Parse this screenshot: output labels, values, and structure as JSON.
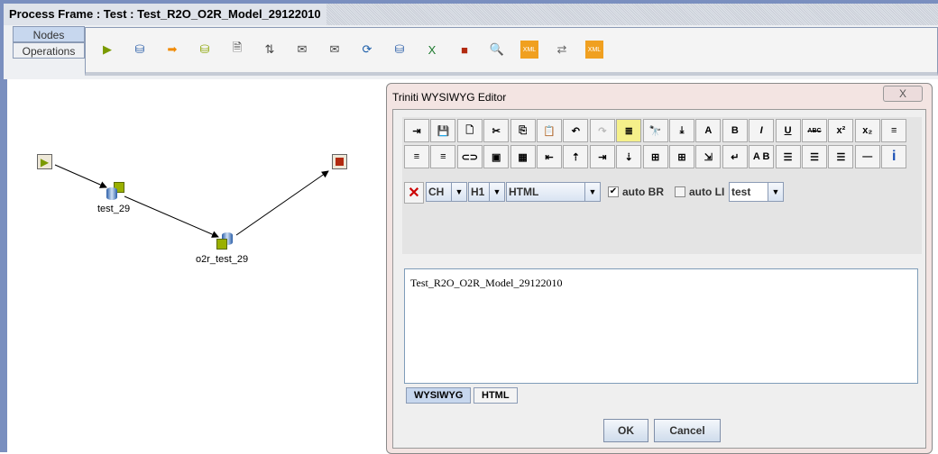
{
  "window": {
    "title": "Process Frame : Test : Test_R2O_O2R_Model_29122010"
  },
  "tabs": [
    {
      "label": "Nodes",
      "selected": true
    },
    {
      "label": "Operations",
      "selected": false
    }
  ],
  "toolbar": {
    "icons": [
      {
        "name": "start-node-icon",
        "glyph": "▶",
        "color": "#7a9a00"
      },
      {
        "name": "db-to-object-icon",
        "glyph": "⛁",
        "color": "#2a5ea8"
      },
      {
        "name": "arrow-right-icon",
        "glyph": "➡",
        "color": "#f08a00"
      },
      {
        "name": "object-to-db-icon",
        "glyph": "⛁",
        "color": "#8aa400"
      },
      {
        "name": "file-db-icon",
        "glyph": "🗎",
        "color": "#444"
      },
      {
        "name": "file-transfer-icon",
        "glyph": "⇅",
        "color": "#444"
      },
      {
        "name": "mail-add-icon",
        "glyph": "✉",
        "color": "#444"
      },
      {
        "name": "mail-file-icon",
        "glyph": "✉",
        "color": "#444"
      },
      {
        "name": "web-service-icon",
        "glyph": "⟳",
        "color": "#1a5ca8"
      },
      {
        "name": "db-file-icon",
        "glyph": "⛁",
        "color": "#2a5ea8"
      },
      {
        "name": "excel-icon",
        "glyph": "X",
        "color": "#1d7a2e"
      },
      {
        "name": "stop-node-icon",
        "glyph": "■",
        "color": "#b22a10"
      },
      {
        "name": "search-user-icon",
        "glyph": "🔍",
        "color": "#444"
      },
      {
        "name": "xml-object-icon",
        "glyph": "XML",
        "color": "#d06000"
      },
      {
        "name": "transform-icon",
        "glyph": "⇄",
        "color": "#666"
      },
      {
        "name": "xml-db-icon",
        "glyph": "XML",
        "color": "#8aa400"
      }
    ]
  },
  "canvas": {
    "nodes": [
      {
        "name": "start-node",
        "label": ""
      },
      {
        "name": "test-29-node",
        "label": "test_29"
      },
      {
        "name": "o2r-test-29-node",
        "label": "o2r_test_29"
      },
      {
        "name": "stop-node",
        "label": ""
      }
    ]
  },
  "dialog": {
    "title": "Triniti WYSIWYG Editor",
    "close_glyph": "X",
    "row1": [
      {
        "name": "insert-file",
        "g": "⇥"
      },
      {
        "name": "save",
        "g": "💾"
      },
      {
        "name": "new",
        "g": "🗋"
      },
      {
        "name": "cut",
        "g": "✂"
      },
      {
        "name": "copy",
        "g": "⎘"
      },
      {
        "name": "paste",
        "g": "📋"
      },
      {
        "name": "undo",
        "g": "↶"
      },
      {
        "name": "redo",
        "g": "↷"
      },
      {
        "name": "highlight",
        "g": "≣"
      },
      {
        "name": "find",
        "g": "🔭"
      },
      {
        "name": "find-next",
        "g": "⤓"
      },
      {
        "name": "font",
        "g": "A"
      },
      {
        "name": "bold",
        "g": "B"
      },
      {
        "name": "italic",
        "g": "I"
      },
      {
        "name": "underline",
        "g": "U"
      },
      {
        "name": "strikethrough",
        "g": "ABC"
      },
      {
        "name": "superscript",
        "g": "x²"
      },
      {
        "name": "subscript",
        "g": "x₂"
      },
      {
        "name": "align-left",
        "g": "≡"
      }
    ],
    "row2": [
      {
        "name": "align-center",
        "g": "≡"
      },
      {
        "name": "align-right",
        "g": "≡"
      },
      {
        "name": "link",
        "g": "⊂⊃"
      },
      {
        "name": "image",
        "g": "▣"
      },
      {
        "name": "table",
        "g": "▦"
      },
      {
        "name": "insert-column",
        "g": "⇤"
      },
      {
        "name": "insert-row",
        "g": "⇡"
      },
      {
        "name": "delete-column",
        "g": "⇥"
      },
      {
        "name": "delete-row",
        "g": "⇣"
      },
      {
        "name": "table-props",
        "g": "⊞"
      },
      {
        "name": "cell-props",
        "g": "⊞"
      },
      {
        "name": "indent",
        "g": "⇲"
      },
      {
        "name": "line-break",
        "g": "↵"
      },
      {
        "name": "anchor",
        "g": "A B"
      },
      {
        "name": "bullet-list",
        "g": "☰"
      },
      {
        "name": "numbered-list",
        "g": "☰"
      },
      {
        "name": "list-item",
        "g": "☰"
      },
      {
        "name": "horizontal-rule",
        "g": "—"
      },
      {
        "name": "info",
        "g": "i"
      }
    ],
    "clear_glyph": "✕",
    "combo_ch": "CH",
    "combo_h1": "H1",
    "combo_format": "HTML",
    "auto_br": {
      "label": "auto BR",
      "checked": true
    },
    "auto_li": {
      "label": "auto LI",
      "checked": false
    },
    "combo_style": "test",
    "content": "Test_R2O_O2R_Model_29122010",
    "editor_tabs": [
      {
        "label": "WYSIWYG",
        "selected": true
      },
      {
        "label": "HTML",
        "selected": false
      }
    ],
    "ok": "OK",
    "cancel": "Cancel"
  }
}
